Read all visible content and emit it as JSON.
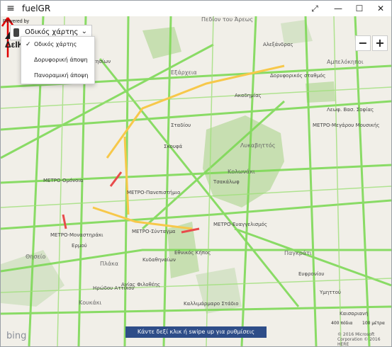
{
  "window": {
    "title": "fuelGR",
    "menu_icon": "hamburger-icon",
    "minimize_glyph": "—",
    "maximize_glyph": "☐",
    "close_glyph": "✕",
    "fullscreen_glyph": "⤢"
  },
  "view_selector": {
    "selected": "Οδικός χάρτης",
    "options": [
      "Οδικός χάρτης",
      "Δορυφορική άποψη",
      "Πανοραμική άποψη"
    ],
    "check_glyph": "✓",
    "chevron_glyph": "⌄"
  },
  "zoom": {
    "out_label": "−",
    "in_label": "+"
  },
  "map": {
    "labels": [
      "Πεδίον του Άρεως",
      "Λυκαβηττός",
      "Πατησίων",
      "Σταδίου",
      "Ακαδημίας",
      "ΜΕΤΡΟ-Ομόνοια",
      "ΜΕΤΡΟ-Πανεπιστήμιο",
      "ΜΕΤΡΟ-Σύνταγμα",
      "ΜΕΤΡΟ-Μοναστηράκι",
      "ΜΕΤΡΟ-Ευαγγελισμός",
      "ΜΕΤΡΟ-Μεγάρου Μουσικής",
      "Κολωνάκι",
      "Εξάρχεια",
      "Θησείο",
      "Πλάκα",
      "Κουκάκι",
      "Παγκράτι",
      "Αμπελόκηποι",
      "Καισαριανή",
      "Καλλιμάρμαρο Στάδιο",
      "Ευφρονίου",
      "Υμηττού",
      "Αλεξάνδρας",
      "Λεωφ. Βασ. Σοφίας",
      "Τσακάλωφ",
      "Σκουφά",
      "Κυδαθηναίων",
      "Αγίας Φιλοθέης",
      "Ερμού",
      "Δορυφορικός σταθμός",
      "Εθνικός Κήπος",
      "Ηρώδου Αττικού"
    ]
  },
  "hint": "Κάντε δεξί κλικ ή swipe up για ρυθμίσεις",
  "logo": {
    "powered_by": "Powered by",
    "brand": "ΔεΙΚΤΟ"
  },
  "bing": "bing",
  "scale": {
    "feet": "400 πόδια",
    "meters": "100 μέτρα"
  },
  "copyright": "© 2016 Microsoft Corporation  © 2016 HERE",
  "colors": {
    "road_fast": "#7ed957",
    "road_slow": "#e84b4b",
    "road_mid": "#f7c84a",
    "park": "#c7dfb1",
    "hint_bg": "#2e4d88",
    "arrow": "#e00000"
  }
}
